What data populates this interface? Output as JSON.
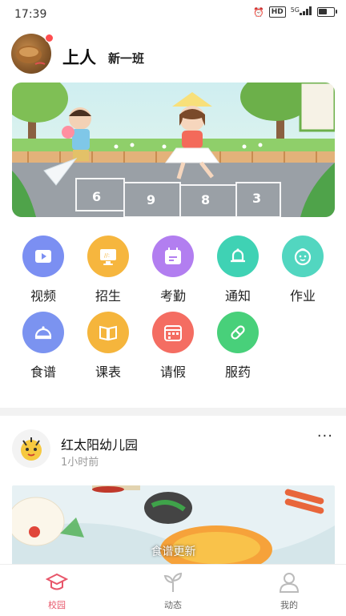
{
  "status_bar": {
    "time": "17:39",
    "network": "HD",
    "signal": "5G",
    "battery_level": 0.6
  },
  "profile": {
    "name": "上人",
    "class_name": "新一班"
  },
  "features": [
    {
      "label": "视频",
      "icon": "video-icon",
      "color": "#7b8ff2"
    },
    {
      "label": "招生",
      "icon": "enrollment-icon",
      "color": "#f6b63e"
    },
    {
      "label": "考勤",
      "icon": "attendance-icon",
      "color": "#b27ef0"
    },
    {
      "label": "通知",
      "icon": "notification-bell-icon",
      "color": "#3fd2b4"
    },
    {
      "label": "作业",
      "icon": "homework-face-icon",
      "color": "#52d6c0"
    },
    {
      "label": "食谱",
      "icon": "recipe-cloche-icon",
      "color": "#7b93f0"
    },
    {
      "label": "课表",
      "icon": "schedule-book-icon",
      "color": "#f5b53c"
    },
    {
      "label": "请假",
      "icon": "leave-calendar-icon",
      "color": "#f46d62"
    },
    {
      "label": "服药",
      "icon": "medicine-pill-icon",
      "color": "#48d07a"
    }
  ],
  "post": {
    "author": "红太阳幼儿园",
    "time": "1小时前",
    "more": "···",
    "image_caption": "食谱更新"
  },
  "tabs": [
    {
      "label": "校园",
      "icon": "graduation-cap-icon",
      "active": true
    },
    {
      "label": "动态",
      "icon": "sprout-icon",
      "active": false
    },
    {
      "label": "我的",
      "icon": "user-icon",
      "active": false
    }
  ],
  "colors": {
    "accent": "#e8566a",
    "divider": "#f2f2f2"
  }
}
